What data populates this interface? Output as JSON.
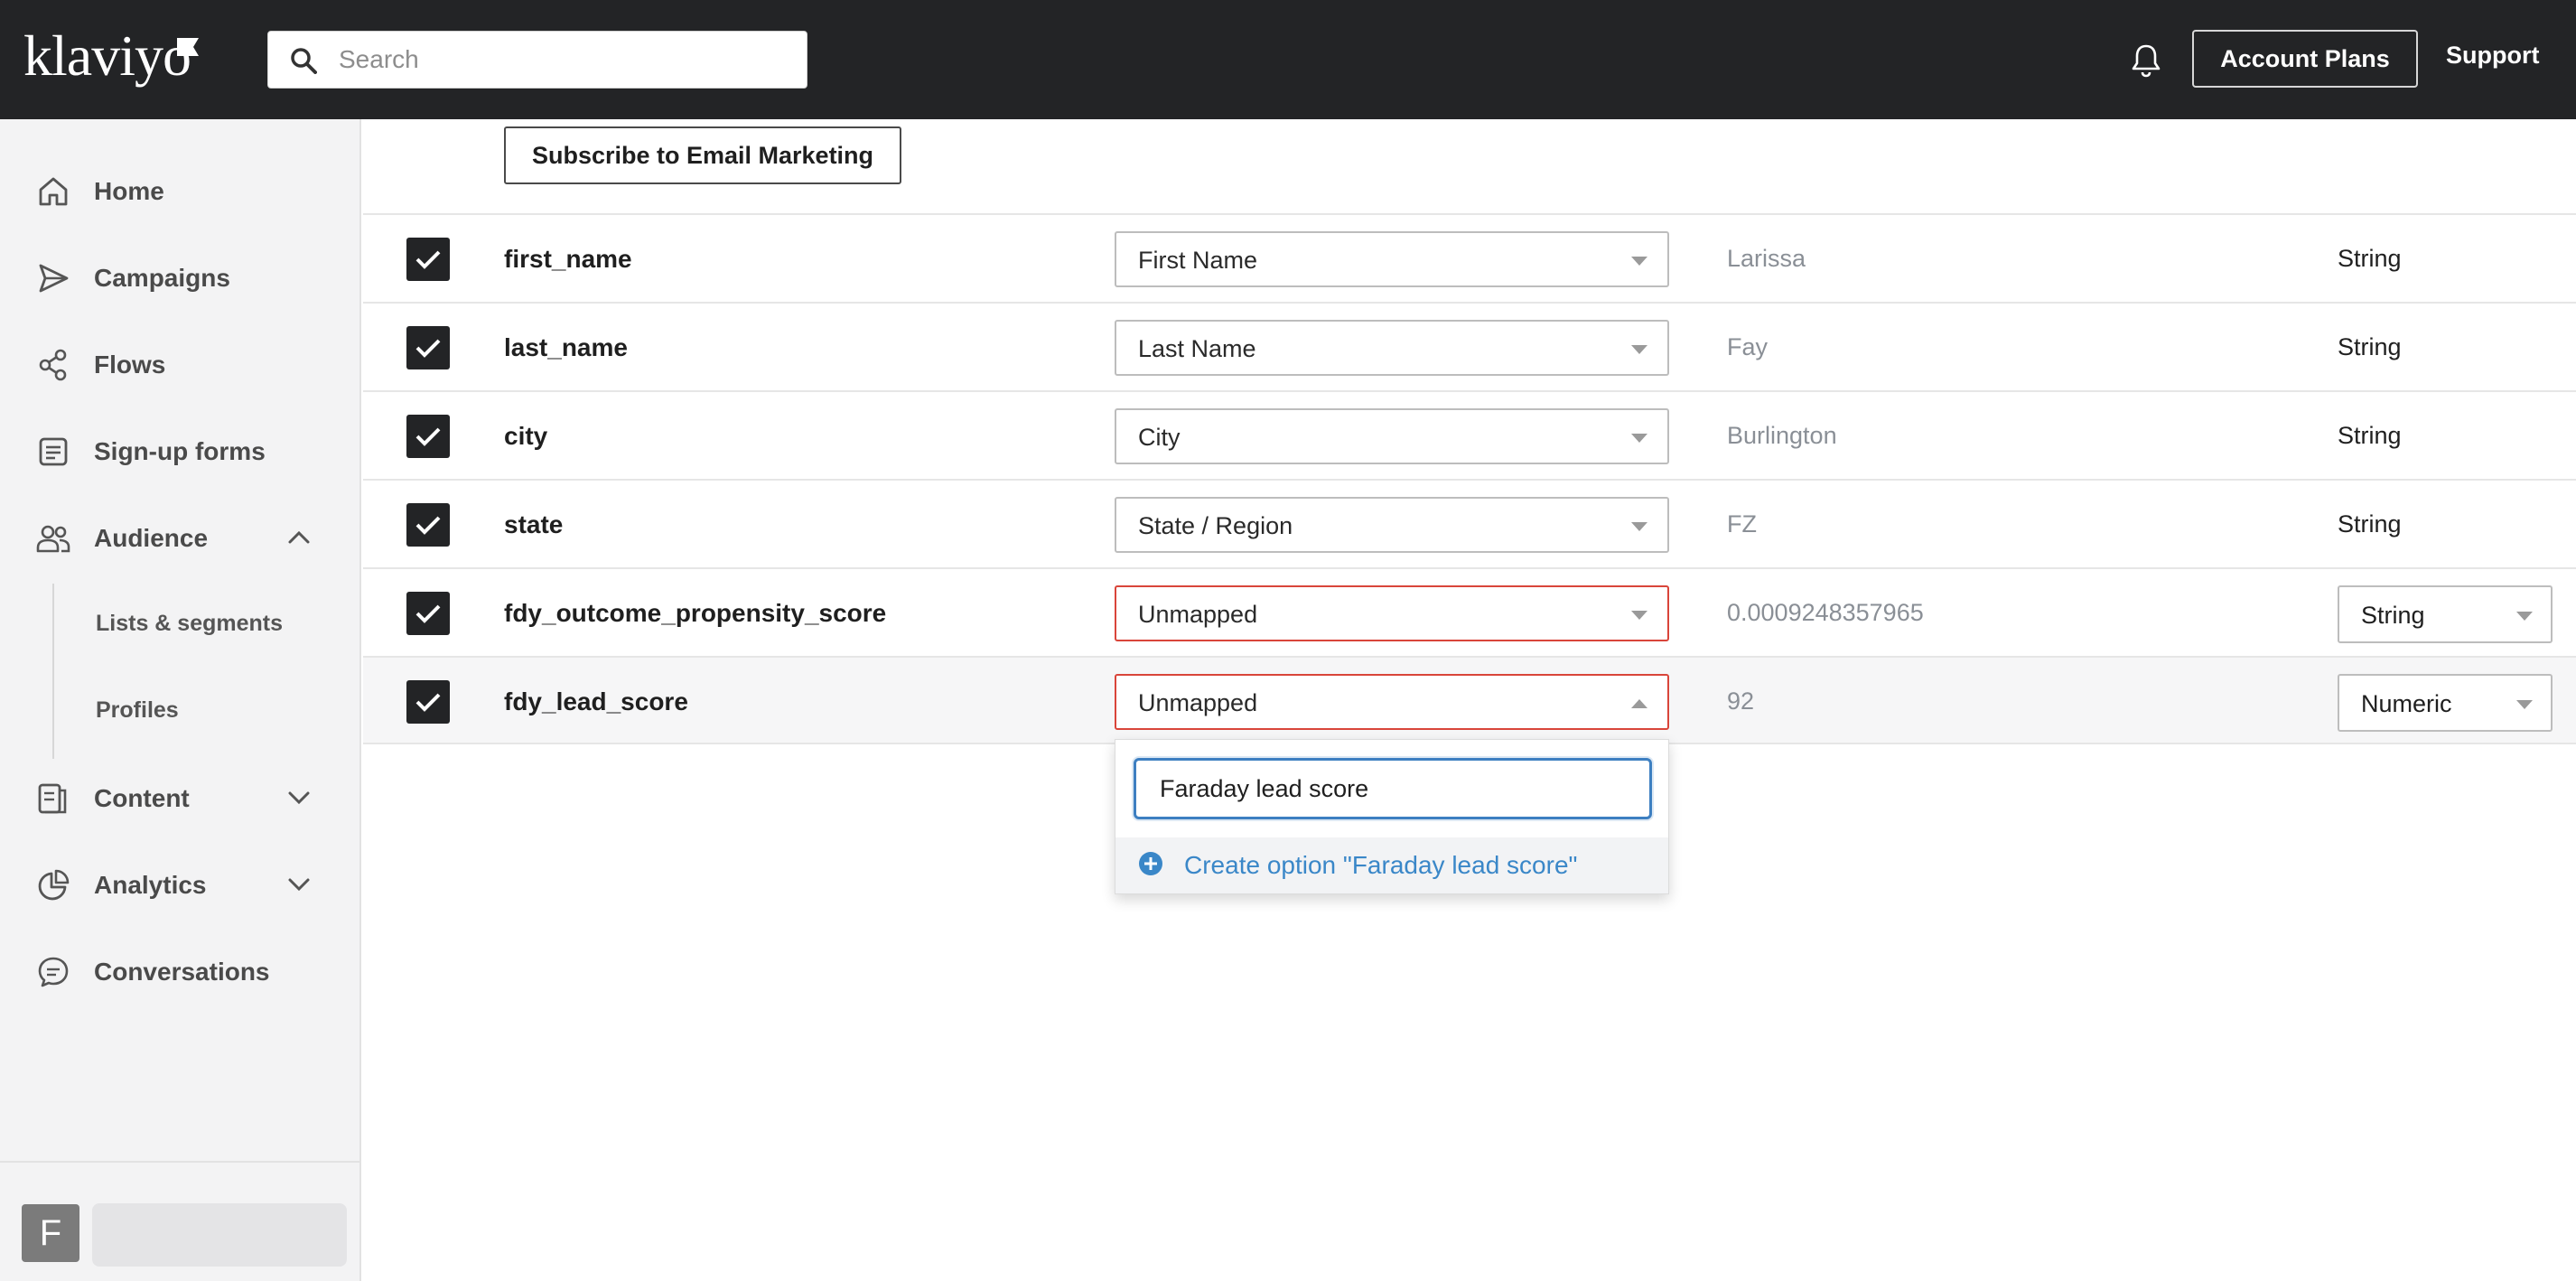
{
  "topbar": {
    "logo_text": "klaviyo",
    "search_placeholder": "Search",
    "account_plans_label": "Account Plans",
    "support_label": "Support"
  },
  "sidebar": {
    "items": [
      {
        "label": "Home",
        "icon": "home-icon"
      },
      {
        "label": "Campaigns",
        "icon": "send-icon"
      },
      {
        "label": "Flows",
        "icon": "flows-icon"
      },
      {
        "label": "Sign-up forms",
        "icon": "form-icon"
      },
      {
        "label": "Audience",
        "icon": "people-icon",
        "expanded": true
      },
      {
        "label": "Content",
        "icon": "content-icon",
        "expanded": false
      },
      {
        "label": "Analytics",
        "icon": "analytics-icon",
        "expanded": false
      },
      {
        "label": "Conversations",
        "icon": "chat-icon"
      }
    ],
    "audience_sub_items": [
      "Lists & segments",
      "Profiles"
    ],
    "user_initial": "F"
  },
  "main": {
    "subscribe_label": "Subscribe to Email Marketing",
    "rows": [
      {
        "field": "first_name",
        "mapping": "First Name",
        "sample": "Larissa",
        "type": "String",
        "checked": true,
        "error": false,
        "type_select": false
      },
      {
        "field": "last_name",
        "mapping": "Last Name",
        "sample": "Fay",
        "type": "String",
        "checked": true,
        "error": false,
        "type_select": false
      },
      {
        "field": "city",
        "mapping": "City",
        "sample": "Burlington",
        "type": "String",
        "checked": true,
        "error": false,
        "type_select": false
      },
      {
        "field": "state",
        "mapping": "State / Region",
        "sample": "FZ",
        "type": "String",
        "checked": true,
        "error": false,
        "type_select": false
      },
      {
        "field": "fdy_outcome_propensity_score",
        "mapping": "Unmapped",
        "sample": "0.0009248357965",
        "type": "String",
        "checked": true,
        "error": true,
        "type_select": true
      },
      {
        "field": "fdy_lead_score",
        "mapping": "Unmapped",
        "sample": "92",
        "type": "Numeric",
        "checked": true,
        "error": true,
        "type_select": true,
        "open": true
      }
    ]
  },
  "dropdown": {
    "search_value": "Faraday lead score",
    "create_option_label": "Create option \"Faraday lead score\""
  },
  "colors": {
    "topbar": "#232426",
    "sidebar": "#f3f3f4",
    "error_border": "#d9453a",
    "focus_border": "#3d7fc1",
    "link_blue": "#3a87c8"
  }
}
